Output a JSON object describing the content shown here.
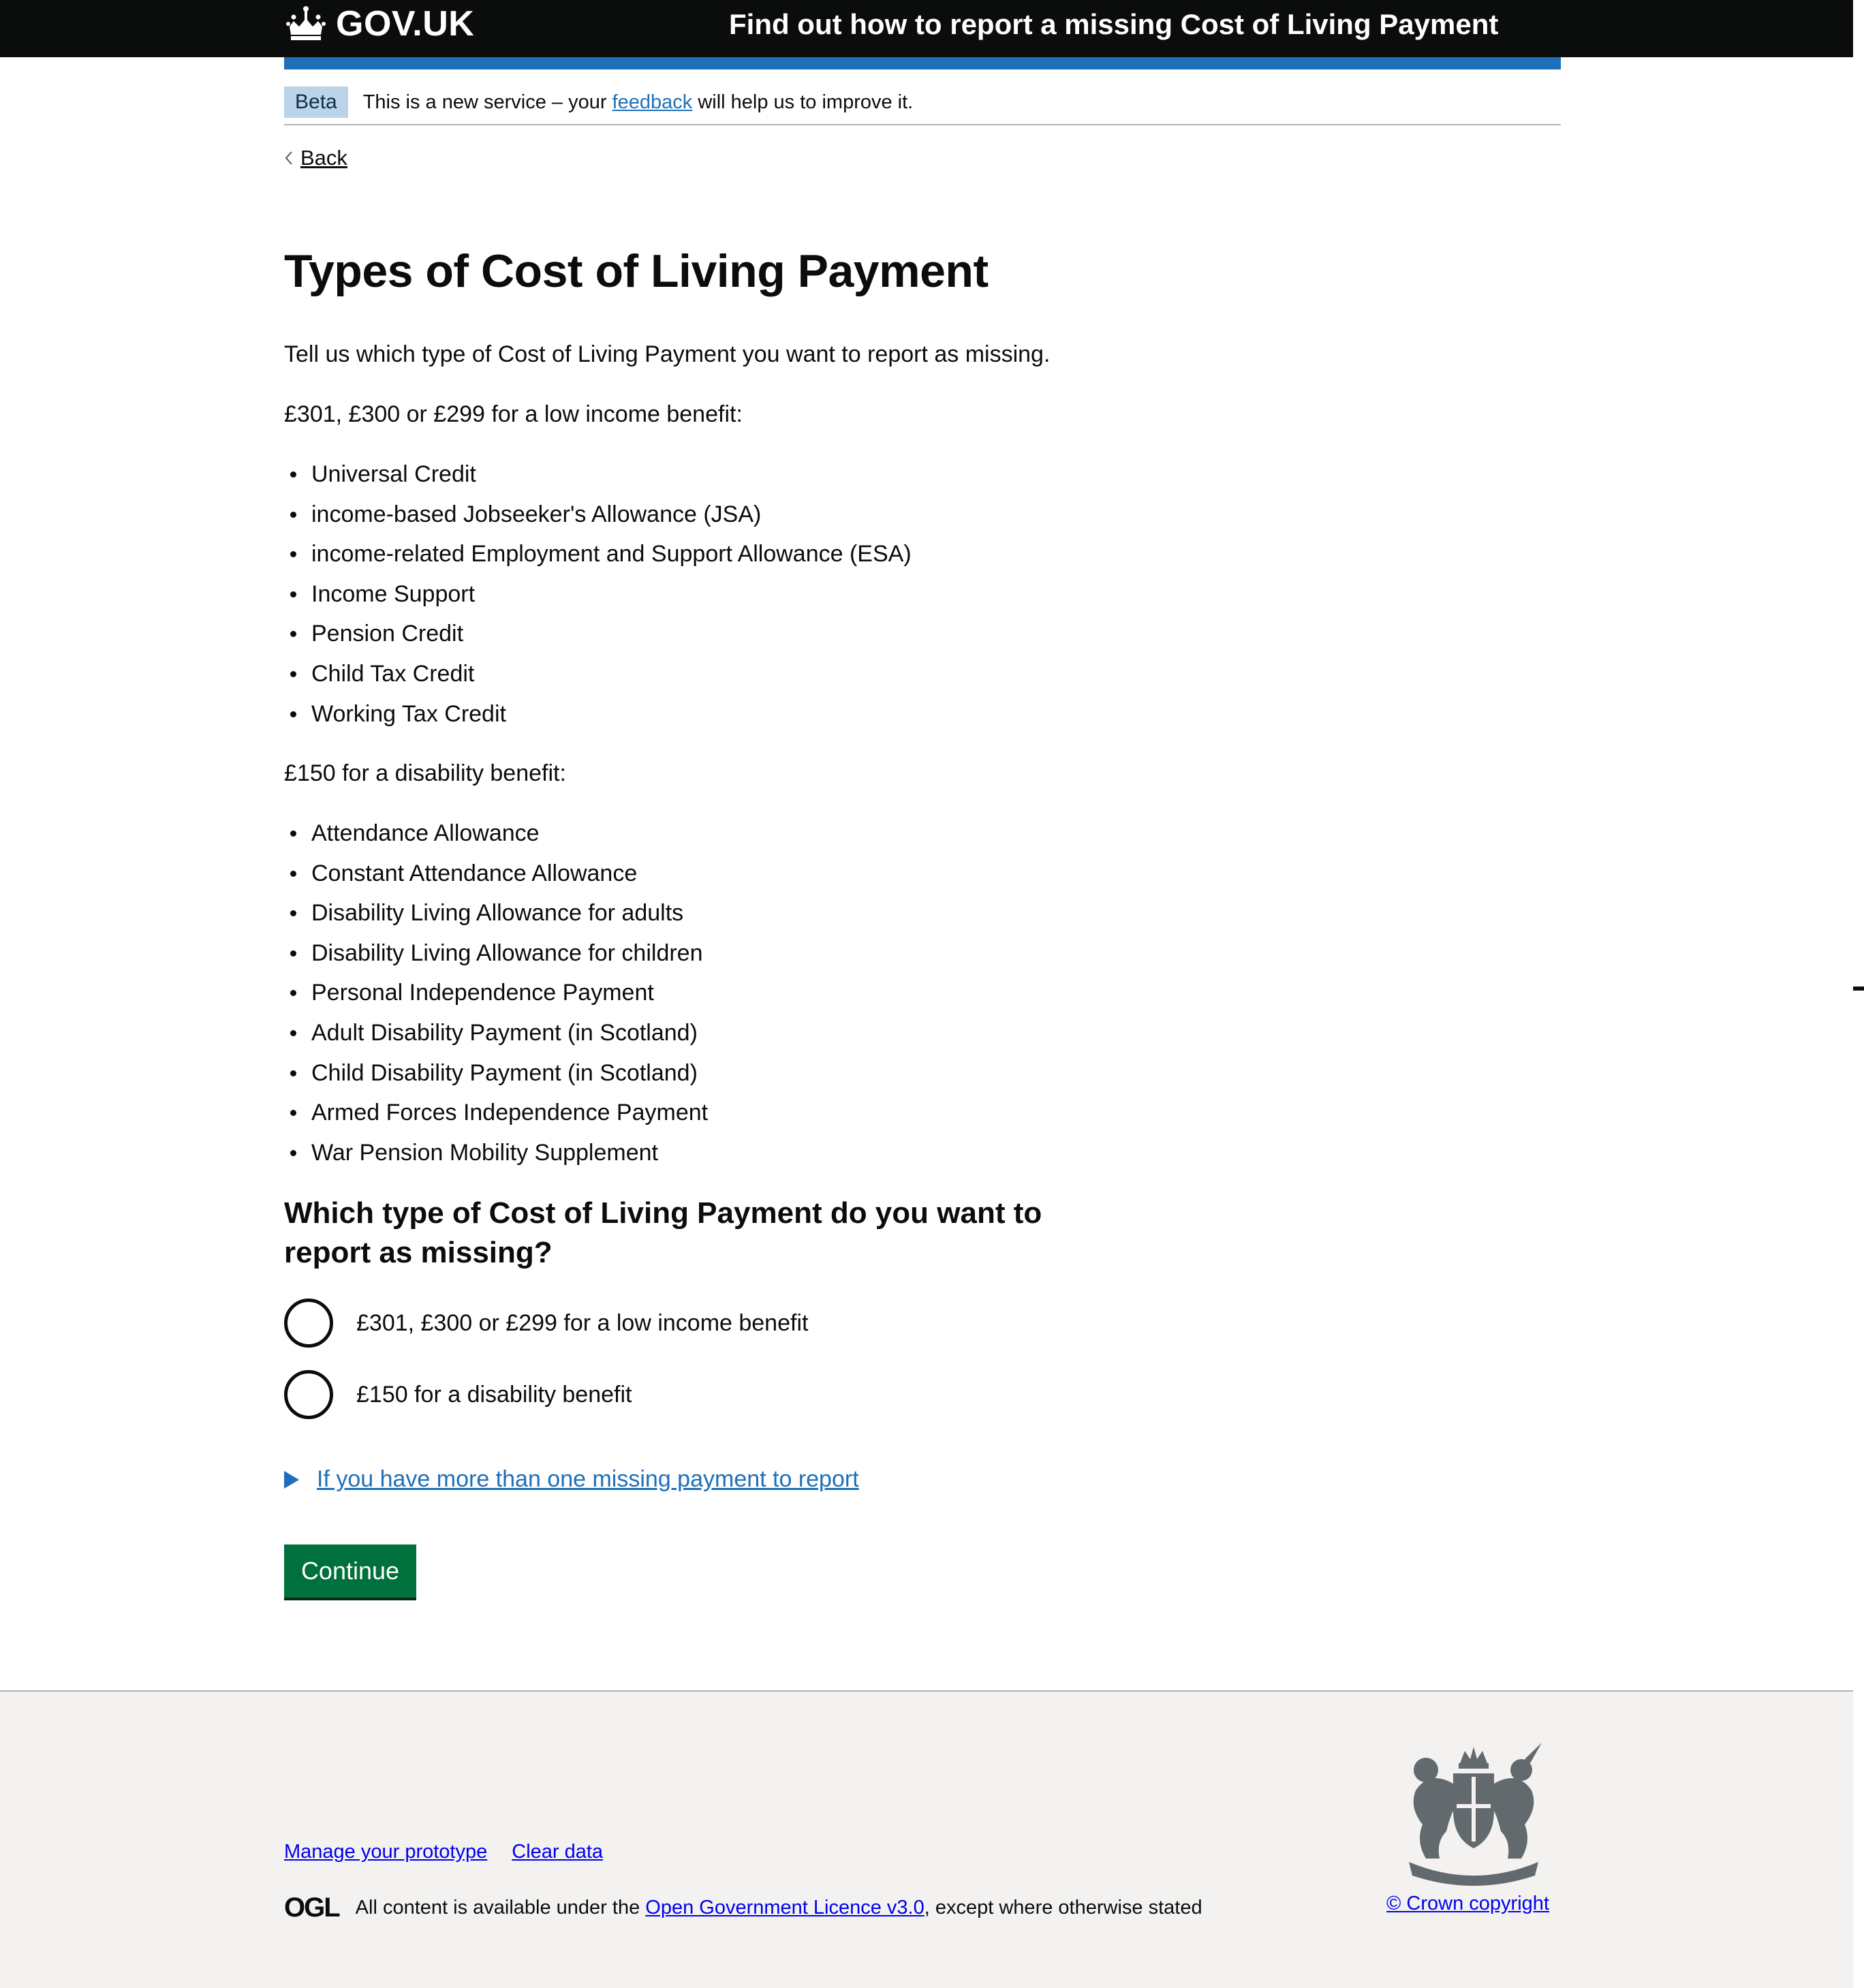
{
  "header": {
    "logo_text": "GOV.UK",
    "service_name": "Find out how to report a missing Cost of Living Payment",
    "colors": {
      "background": "#0b0c0c",
      "accent_bar": "#1d70b8"
    }
  },
  "phase_banner": {
    "tag": "Beta",
    "text_before": "This is a new service – your ",
    "link": "feedback",
    "text_after": " will help us to improve it."
  },
  "back": {
    "label": "Back"
  },
  "page": {
    "title": "Types of Cost of Living Payment",
    "intro": "Tell us which type of Cost of Living Payment you want to report as missing.",
    "low_income_heading": "£301, £300 or £299 for a low income benefit:",
    "low_income_items": [
      "Universal Credit",
      "income-based Jobseeker's Allowance (JSA)",
      "income-related Employment and Support Allowance (ESA)",
      "Income Support",
      "Pension Credit",
      "Child Tax Credit",
      "Working Tax Credit"
    ],
    "disability_heading": "£150 for a disability benefit:",
    "disability_items": [
      "Attendance Allowance",
      "Constant Attendance Allowance",
      "Disability Living Allowance for adults",
      "Disability Living Allowance for children",
      "Personal Independence Payment",
      "Adult Disability Payment (in Scotland)",
      "Child Disability Payment (in Scotland)",
      "Armed Forces Independence Payment",
      "War Pension Mobility Supplement"
    ]
  },
  "form": {
    "question": "Which type of Cost of Living Payment do you want to report as missing?",
    "options": [
      "£301, £300 or £299 for a low income benefit",
      "£150 for a disability benefit"
    ],
    "details_summary": "If you have more than one missing payment to report",
    "continue_label": "Continue",
    "colors": {
      "button": "#00703c",
      "link": "#1d70b8"
    }
  },
  "footer": {
    "links": [
      "Manage your prototype",
      "Clear data"
    ],
    "ogl_logo": "OGL",
    "licence_before": "All content is available under the ",
    "licence_link": "Open Government Licence v3.0",
    "licence_after": ", except where otherwise stated",
    "copyright": "© Crown copyright",
    "icons": {
      "crest": "royal-coat-of-arms-icon",
      "crown": "crown-icon"
    }
  }
}
